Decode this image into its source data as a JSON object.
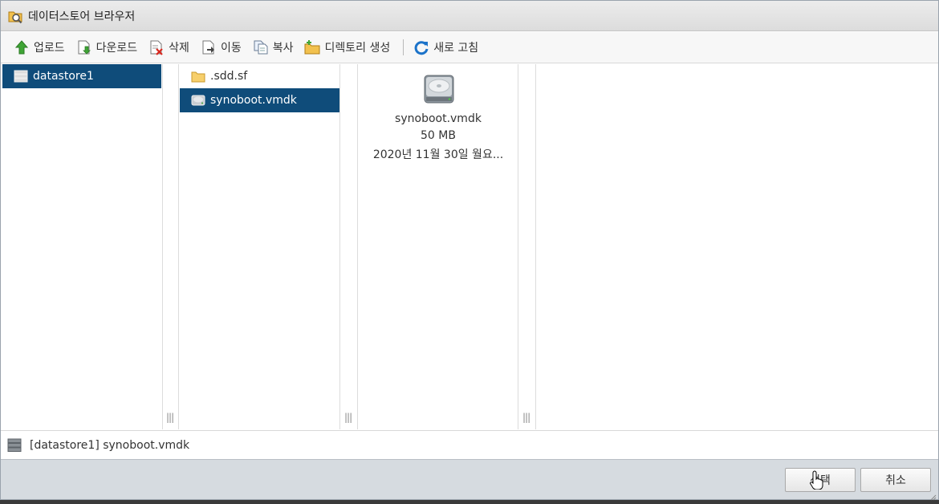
{
  "window": {
    "title": "데이터스토어 브라우저",
    "icon": "datastore-browser-icon"
  },
  "toolbar": {
    "upload": {
      "label": "업로드",
      "icon": "upload-arrow-icon"
    },
    "download": {
      "label": "다운로드",
      "icon": "download-icon"
    },
    "delete": {
      "label": "삭제",
      "icon": "delete-icon"
    },
    "move": {
      "label": "이동",
      "icon": "move-icon"
    },
    "copy": {
      "label": "복사",
      "icon": "copy-icon"
    },
    "mkdir": {
      "label": "디렉토리 생성",
      "icon": "new-folder-icon"
    },
    "refresh": {
      "label": "새로 고침",
      "icon": "refresh-icon"
    }
  },
  "datastores": [
    {
      "label": "datastore1",
      "selected": true
    }
  ],
  "files": [
    {
      "label": ".sdd.sf",
      "type": "folder",
      "selected": false
    },
    {
      "label": "synoboot.vmdk",
      "type": "disk",
      "selected": true
    }
  ],
  "preview": {
    "name": "synoboot.vmdk",
    "size": "50 MB",
    "modified": "2020년 11월 30일 월요..."
  },
  "status": {
    "path": "[datastore1] synoboot.vmdk"
  },
  "buttons": {
    "select": "선택",
    "cancel": "취소"
  },
  "colors": {
    "selection": "#0f4c7a",
    "footer": "#d6dbe0"
  }
}
